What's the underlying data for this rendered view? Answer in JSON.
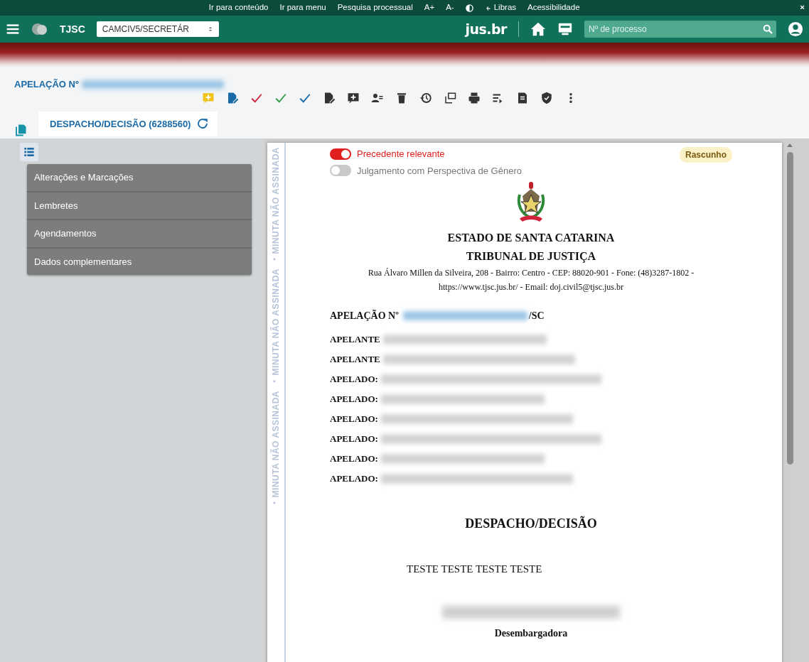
{
  "accessibility_bar": {
    "links": [
      "Ir para conteúdo",
      "Ir para menu",
      "Pesquisa processual",
      "A+",
      "A-"
    ],
    "libras": "Libras",
    "accessibility": "Acessibilidade",
    "close": "×"
  },
  "header": {
    "court": "TJSC",
    "unit_select": "CAMCIV5/SECRETÁR",
    "brand": "jus.br",
    "search": {
      "placeholder": "Nº de processo"
    }
  },
  "case_title": {
    "label": "APELAÇÃO Nº"
  },
  "tabs": [
    {
      "label": "DESPACHO/DECISÃO (6288560)",
      "selected": true
    }
  ],
  "side_menu": [
    "Alterações e Marcações",
    "Lembretes",
    "Agendamentos",
    "Dados complementares"
  ],
  "margin_stamp": [
    "MINUTA NÃO ASSINADA",
    "MINUTA NÃO ASSINADA",
    "MINUTA NÃO ASSINADA"
  ],
  "document": {
    "toggles": [
      {
        "label": "Precedente relevante",
        "on": true
      },
      {
        "label": "Julgamento com Perspectiva de Gênero",
        "on": false
      }
    ],
    "status_badge": "Rascunho",
    "heading_lines": [
      "ESTADO DE SANTA CATARINA",
      "TRIBUNAL DE JUSTIÇA"
    ],
    "address_lines": [
      "Rua Álvaro Millen da Silveira, 208 - Bairro: Centro - CEP: 88020-901 - Fone: (48)3287-1802 -",
      "https://www.tjsc.jus.br/ - Email: doj.civil5@tjsc.jus.br"
    ],
    "case_line": {
      "label": "APELAÇÃO Nº",
      "suffix": "/SC"
    },
    "parties": [
      "APELANTE",
      "APELANTE",
      "APELADO:",
      "APELADO:",
      "APELADO:",
      "APELADO:",
      "APELADO:",
      "APELADO:"
    ],
    "title": "DESPACHO/DECISÃO",
    "body": "TESTE TESTE TESTE TESTE",
    "signer_role": "Desembargadora"
  }
}
